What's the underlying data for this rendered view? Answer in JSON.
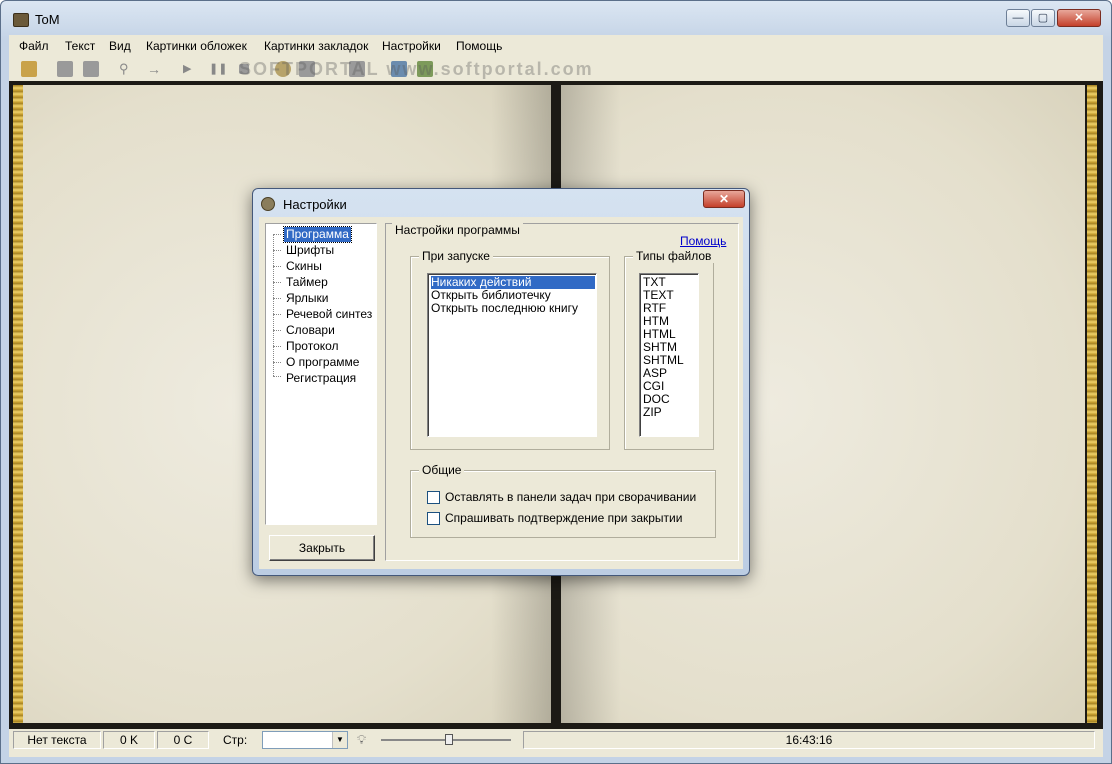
{
  "window": {
    "title": "ToM"
  },
  "menu": [
    "Файл",
    "Текст",
    "Вид",
    "Картинки обложек",
    "Картинки закладок",
    "Настройки",
    "Помощь"
  ],
  "watermark": "SOFTPORTAL www.softportal.com",
  "dialog": {
    "title": "Настройки",
    "tree": [
      "Программа",
      "Шрифты",
      "Скины",
      "Таймер",
      "Ярлыки",
      "Речевой синтез",
      "Словари",
      "Протокол",
      "О программе",
      "Регистрация"
    ],
    "tree_selected": 0,
    "close_button": "Закрыть",
    "section_title": "Настройки программы",
    "help_link": "Помощь",
    "startup": {
      "title": "При запуске",
      "options": [
        "Никаких действий",
        "Открыть библиотечку",
        "Открыть последнюю книгу"
      ],
      "selected": 0
    },
    "filetypes": {
      "title": "Типы файлов",
      "items": [
        "TXT",
        "TEXT",
        "RTF",
        "HTM",
        "HTML",
        "SHTM",
        "SHTML",
        "ASP",
        "CGI",
        "DOC",
        "ZIP"
      ]
    },
    "general": {
      "title": "Общие",
      "options": [
        {
          "label": "Оставлять в панели задач при сворачивании",
          "checked": false
        },
        {
          "label": "Спрашивать подтверждение при закрытии",
          "checked": false
        }
      ]
    }
  },
  "status": {
    "text": "Нет текста",
    "size": "0 K",
    "chars": "0 C",
    "page_label": "Стр:",
    "page_value": "",
    "time": "16:43:16"
  }
}
